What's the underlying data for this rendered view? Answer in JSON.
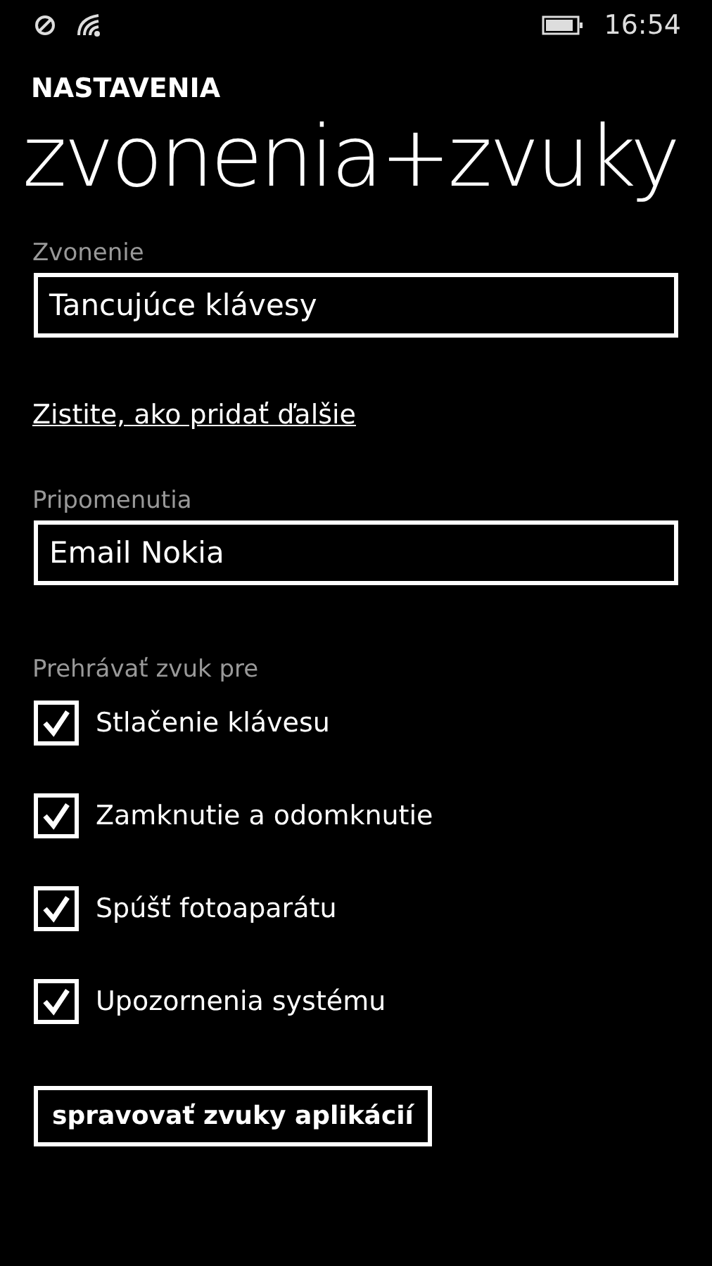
{
  "status_bar": {
    "time": "16:54"
  },
  "header": {
    "app": "NASTAVENIA",
    "title": "zvonenia+zvuky"
  },
  "ringtone": {
    "label": "Zvonenie",
    "value": "Tancujúce klávesy"
  },
  "link": "Zistite, ako pridať ďalšie",
  "reminders": {
    "label": "Pripomenutia",
    "value": "Email Nokia"
  },
  "sounds": {
    "label": "Prehrávať zvuk pre",
    "items": [
      {
        "label": "Stlačenie klávesu",
        "checked": true
      },
      {
        "label": "Zamknutie a odomknutie",
        "checked": true
      },
      {
        "label": "Spúšť fotoaparátu",
        "checked": true
      },
      {
        "label": "Upozornenia systému",
        "checked": true
      }
    ]
  },
  "button": "spravovať zvuky aplikácií"
}
